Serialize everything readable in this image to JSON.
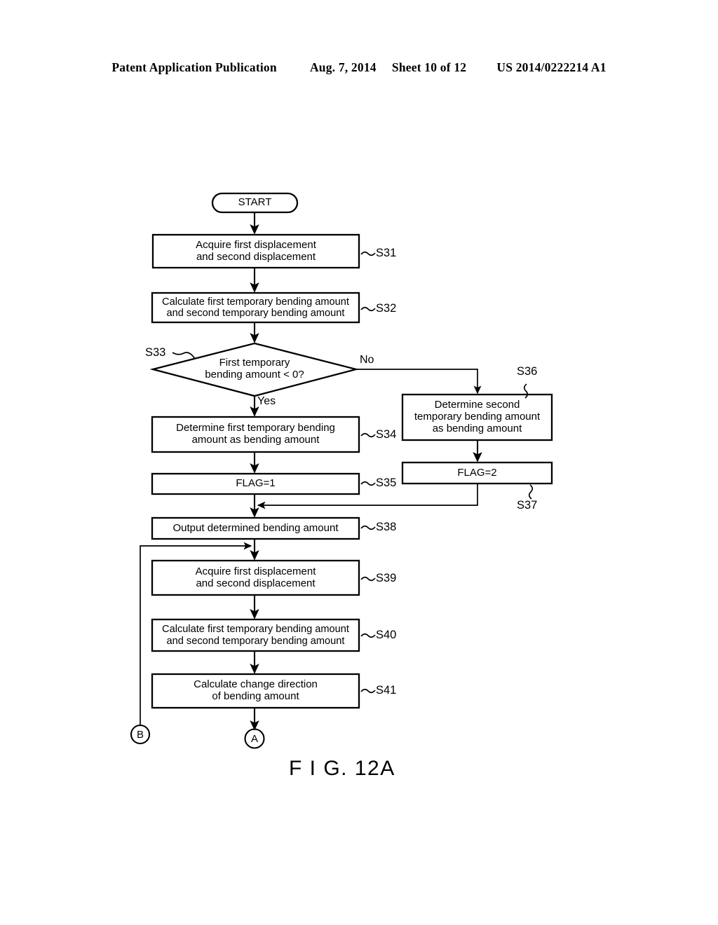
{
  "header": {
    "publication": "Patent Application Publication",
    "date": "Aug. 7, 2014",
    "sheet": "Sheet 10 of 12",
    "patent_number": "US 2014/0222214 A1"
  },
  "figure": {
    "caption": "F I G. 12A"
  },
  "flowchart": {
    "start": {
      "label": "START"
    },
    "nodes": [
      {
        "id": "S31",
        "step": "S31",
        "line1": "Acquire first displacement",
        "line2": "and second displacement"
      },
      {
        "id": "S32",
        "step": "S32",
        "line1": "Calculate first temporary bending amount",
        "line2": "and second temporary bending amount"
      },
      {
        "id": "S33",
        "step": "S33",
        "line1": "First temporary",
        "line2": "bending amount < 0?"
      },
      {
        "id": "S34",
        "step": "S34",
        "line1": "Determine first temporary bending",
        "line2": "amount as bending amount"
      },
      {
        "id": "S35",
        "step": "S35",
        "line1": "FLAG=1",
        "line2": ""
      },
      {
        "id": "S36",
        "step": "S36",
        "line1": "Determine second",
        "line2": "temporary bending amount",
        "line3": "as bending amount"
      },
      {
        "id": "S37",
        "step": "S37",
        "line1": "FLAG=2",
        "line2": ""
      },
      {
        "id": "S38",
        "step": "S38",
        "line1": "Output determined bending amount",
        "line2": ""
      },
      {
        "id": "S39",
        "step": "S39",
        "line1": "Acquire first displacement",
        "line2": "and second displacement"
      },
      {
        "id": "S40",
        "step": "S40",
        "line1": "Calculate first temporary bending amount",
        "line2": "and second temporary bending amount"
      },
      {
        "id": "S41",
        "step": "S41",
        "line1": "Calculate change direction",
        "line2": "of bending amount"
      }
    ],
    "branches": {
      "yes": "Yes",
      "no": "No"
    },
    "connectors": [
      {
        "id": "B",
        "label": "B"
      },
      {
        "id": "A",
        "label": "A"
      }
    ]
  },
  "colors": {
    "ink": "#000000",
    "paper": "#ffffff"
  }
}
